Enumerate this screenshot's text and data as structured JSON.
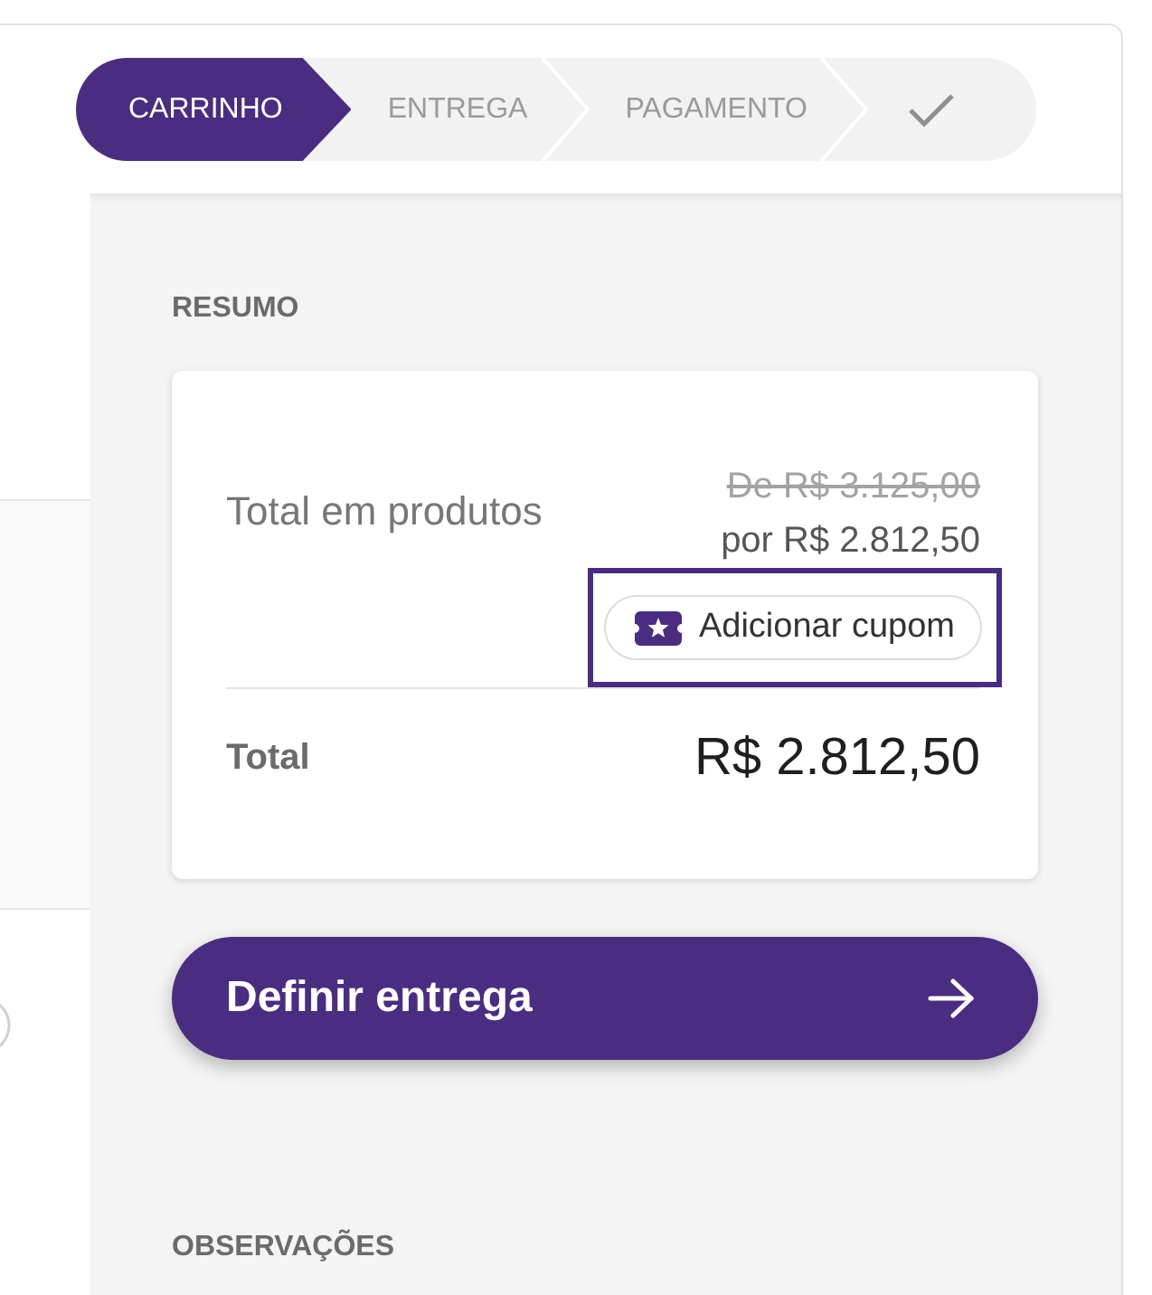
{
  "stepper": {
    "steps": [
      {
        "kind": "text",
        "label": "CARRINHO",
        "selected": true
      },
      {
        "kind": "text",
        "label": "ENTREGA",
        "selected": false
      },
      {
        "kind": "text",
        "label": "PAGAMENTO",
        "selected": false
      },
      {
        "kind": "check",
        "selected": false
      }
    ]
  },
  "summary": {
    "title": "RESUMO",
    "products_label": "Total em produtos",
    "original_price": "De R$ 3.125,00",
    "price": "por R$ 2.812,50",
    "coupon": {
      "label": "Adicionar cupom",
      "focused": true
    },
    "total_label": "Total",
    "total_value": "R$ 2.812,50"
  },
  "primary_button": {
    "label": "Definir entrega"
  },
  "notes": {
    "title": "OBSERVAÇÕES"
  }
}
